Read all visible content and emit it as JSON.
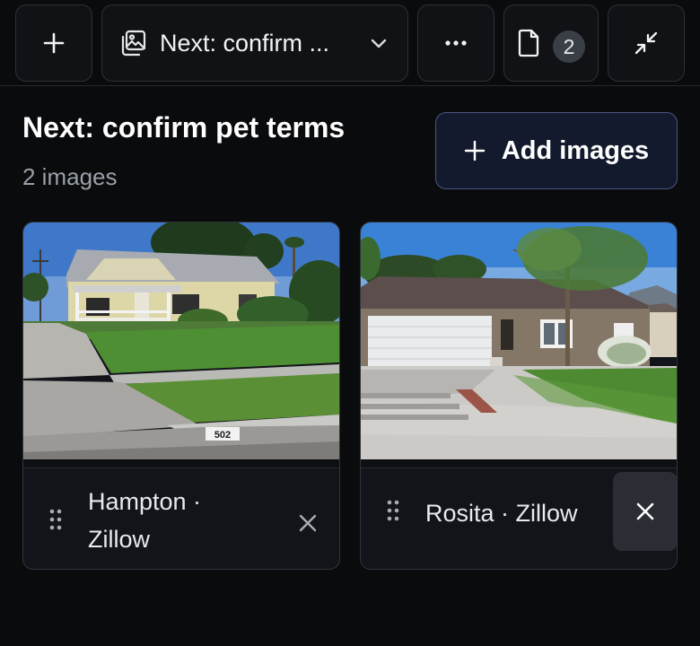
{
  "toolbar": {
    "new_icon": "plus-icon",
    "session_icon": "images-icon",
    "session_title": "Next: confirm ...",
    "session_chevron": "chevron-down-icon",
    "more_icon": "ellipsis-icon",
    "docs_icon": "document-icon",
    "doc_count": "2",
    "collapse_icon": "collapse-arrows-icon"
  },
  "main": {
    "title": "Next: confirm pet terms",
    "image_count": "2 images",
    "add_button_label": "Add images",
    "add_button_icon": "plus-icon"
  },
  "images": [
    {
      "label": "Hampton · Zillow",
      "house_number": "502",
      "drag_icon": "drag-handle-icon",
      "remove_icon": "close-icon"
    },
    {
      "label": "Rosita · Zillow",
      "drag_icon": "drag-handle-icon",
      "remove_icon": "close-icon"
    }
  ],
  "colors": {
    "background": "#0a0b0d",
    "panel": "#101216",
    "border": "#2c3037",
    "accent_border": "#4a5680",
    "accent_fill": "#141a2e",
    "muted_text": "#9aa0a8"
  }
}
